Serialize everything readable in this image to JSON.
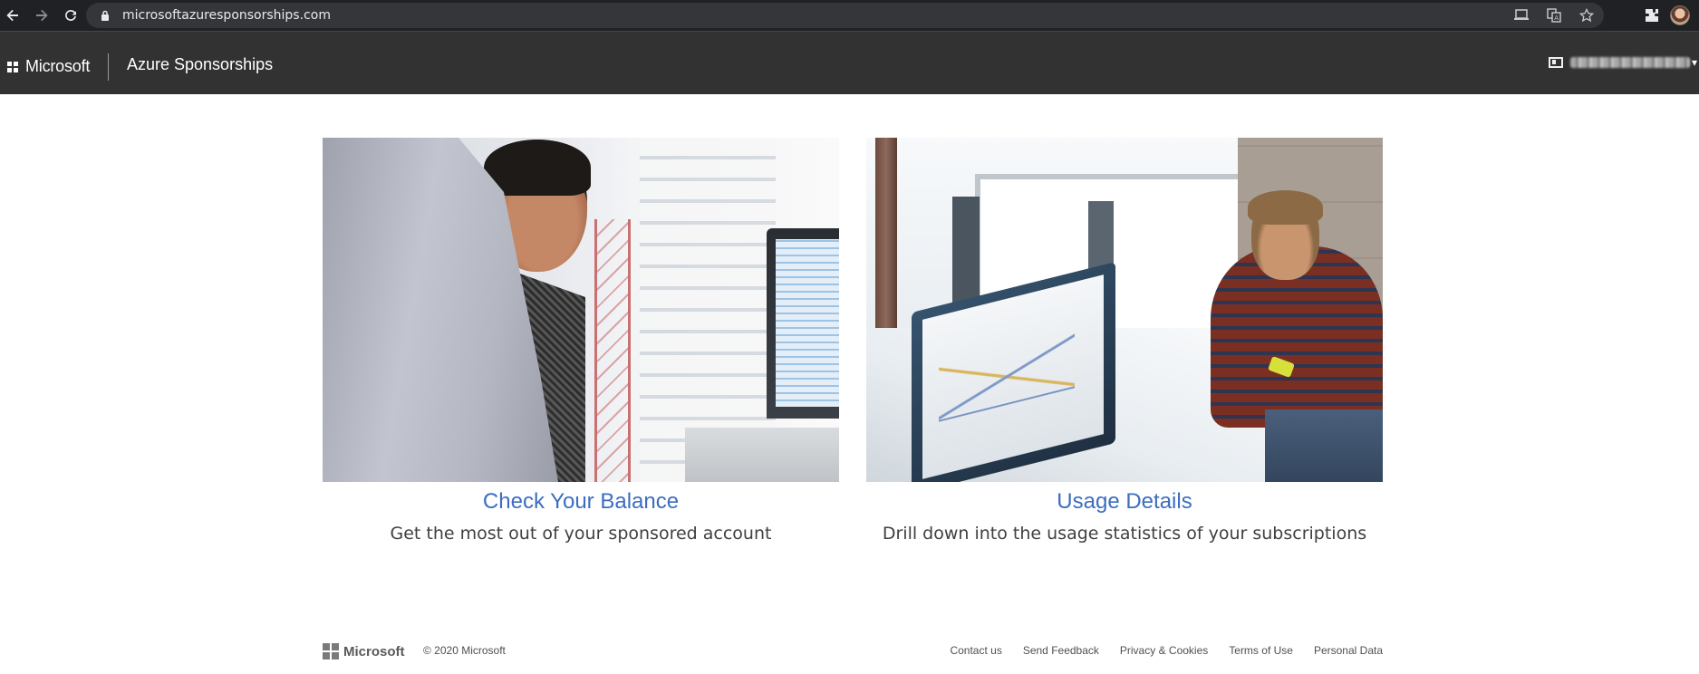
{
  "browser": {
    "url": "microsoftazuresponsorships.com",
    "icons": [
      "back-arrow-icon",
      "forward-arrow-icon",
      "reload-icon",
      "lock-icon",
      "cast-icon",
      "translate-icon",
      "star-icon",
      "extensions-icon",
      "profile-avatar"
    ]
  },
  "header": {
    "brand": "Microsoft",
    "title": "Azure Sponsorships",
    "account_caret": "▾"
  },
  "cards": [
    {
      "title": "Check Your Balance",
      "description": "Get the most out of your sponsored account"
    },
    {
      "title": "Usage Details",
      "description": "Drill down into the usage statistics of your subscriptions"
    }
  ],
  "footer": {
    "brand": "Microsoft",
    "copyright": "© 2020 Microsoft",
    "links": [
      "Contact us",
      "Send Feedback",
      "Privacy & Cookies",
      "Terms of Use",
      "Personal Data"
    ]
  },
  "colors": {
    "browser_bar": "#202124",
    "header_bg": "#323232",
    "link_blue": "#3c6dc0",
    "text_gray": "#404040"
  }
}
